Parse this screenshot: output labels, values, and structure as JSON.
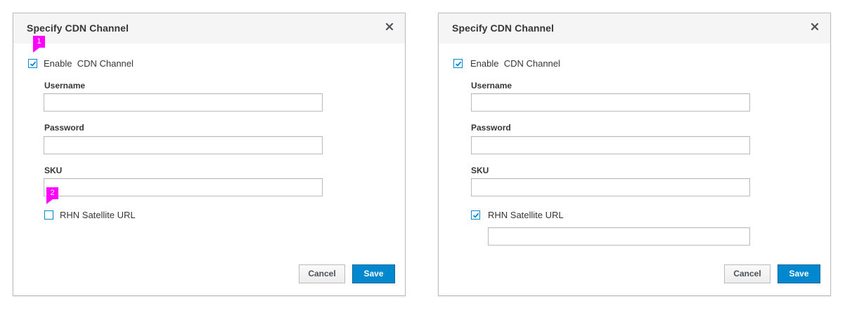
{
  "dialogs": [
    {
      "title": "Specify CDN Channel",
      "enable_cdn": {
        "label": "Enable  CDN Channel",
        "checked": true
      },
      "fields": {
        "username": {
          "label": "Username",
          "value": ""
        },
        "password": {
          "label": "Password",
          "value": ""
        },
        "sku": {
          "label": "SKU",
          "value": ""
        }
      },
      "rhn_satellite": {
        "label": "RHN Satellite URL",
        "checked": false,
        "url_value": ""
      },
      "buttons": {
        "cancel": "Cancel",
        "save": "Save"
      },
      "callouts": [
        "1",
        "2"
      ]
    },
    {
      "title": "Specify CDN Channel",
      "enable_cdn": {
        "label": "Enable  CDN Channel",
        "checked": true
      },
      "fields": {
        "username": {
          "label": "Username",
          "value": ""
        },
        "password": {
          "label": "Password",
          "value": ""
        },
        "sku": {
          "label": "SKU",
          "value": ""
        }
      },
      "rhn_satellite": {
        "label": "RHN Satellite URL",
        "checked": true,
        "url_value": ""
      },
      "buttons": {
        "cancel": "Cancel",
        "save": "Save"
      }
    }
  ],
  "icons": {
    "close": "close-icon",
    "checkmark": "checkmark-icon"
  },
  "colors": {
    "accent": "#0088ce",
    "callout": "#ff00ff",
    "header_bg": "#f5f5f5"
  }
}
